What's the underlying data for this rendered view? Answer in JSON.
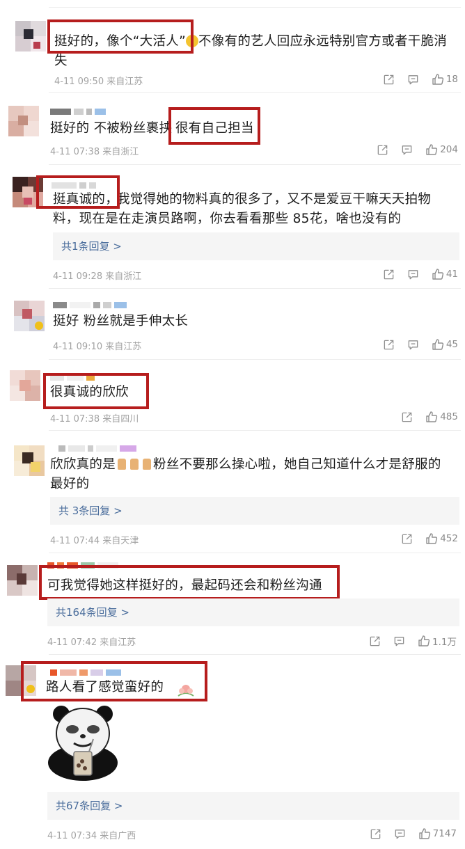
{
  "comments": [
    {
      "text_a": "挺好的，像个“大活人”",
      "text_b": "不像有的艺人回应永远特别官方或者干脆消",
      "text_c": "失",
      "meta": "4-11 09:50 来自江苏",
      "likes": "18"
    },
    {
      "text_a": "挺好的 不被粉丝裹挟",
      "text_b": "很有自己担当",
      "meta": "4-11 07:38 来自浙江",
      "likes": "204"
    },
    {
      "text_a": "挺真诚的，",
      "text_b": "我觉得她的物料真的很多了，又不是爱豆干嘛天天拍物",
      "text_c": "料，现在是在走演员路啊，你去看看那些 85花，啥也没有的",
      "reply": "共1条回复 >",
      "meta": "4-11 09:28 来自浙江",
      "likes": "41"
    },
    {
      "text_a": "挺好 粉丝就是手伸太长",
      "meta": "4-11 09:10 来自江苏",
      "likes": "45"
    },
    {
      "text_a": "很真诚的欣欣",
      "meta": "4-11 07:38 来自四川",
      "likes": "485"
    },
    {
      "text_a": "欣欣真的是",
      "text_b": "粉丝不要那么操心啦，她自己知道什么才是舒服的",
      "text_c": "最好的",
      "reply": "共 3条回复 >",
      "meta": "4-11 07:44 来自天津",
      "likes": "452"
    },
    {
      "text_a": "可我觉得她这样挺好的，最起码还会和粉丝沟通",
      "reply": "共164条回复 >",
      "meta": "4-11 07:42 来自江苏",
      "likes": "1.1万"
    },
    {
      "text_a": "路人看了感觉蛮好的",
      "reply": "共67条回复 >",
      "meta": "4-11 07:34 来自广西",
      "likes": "7147"
    }
  ],
  "colors": {
    "highlight_box": "#b61d1d",
    "reply_link": "#4a6d9c",
    "meta_gray": "#a2a2a2"
  },
  "icons": [
    "share-icon",
    "comment-icon",
    "like-icon",
    "thumbs-up-emoji",
    "smile-emoji",
    "flower-sticker",
    "panda-meme-sticker"
  ]
}
